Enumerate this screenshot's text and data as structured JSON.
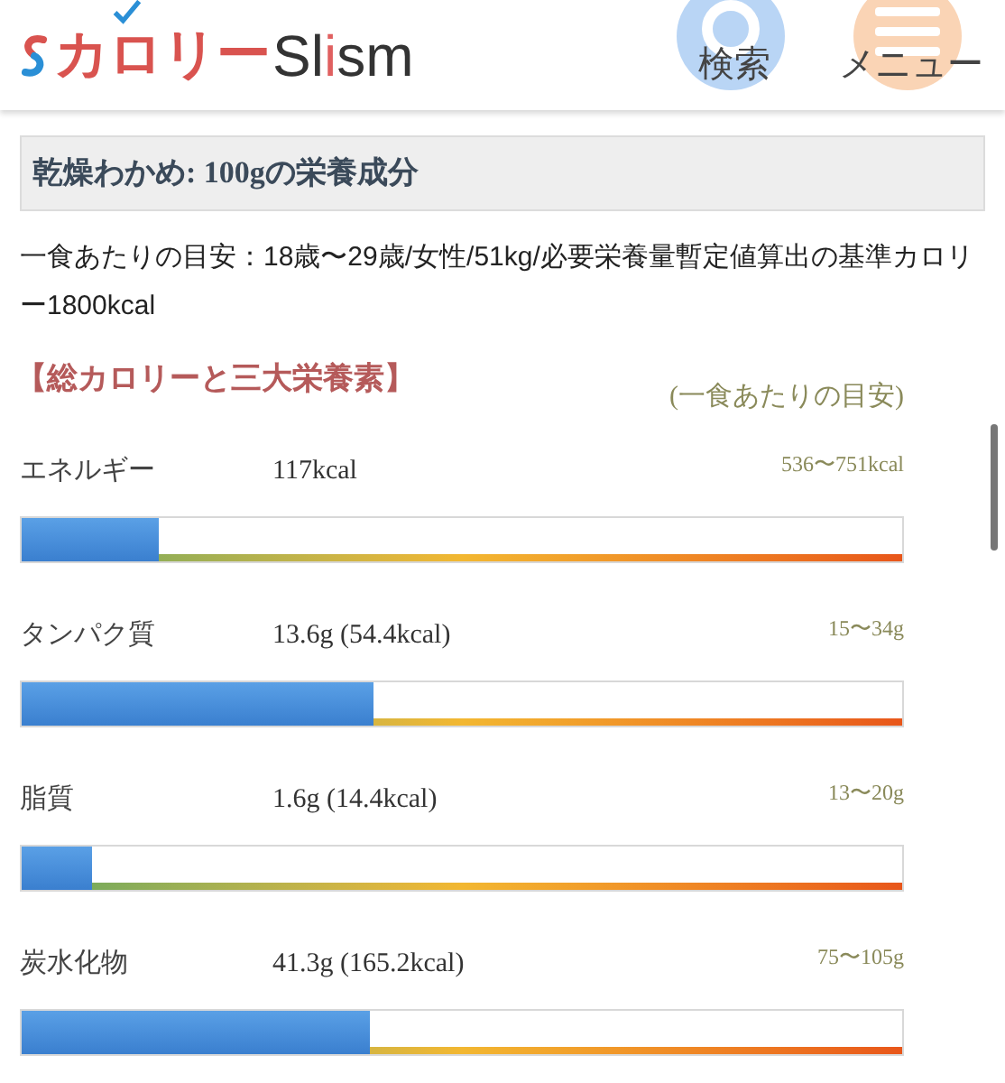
{
  "header": {
    "logo": {
      "kana": "カロリー",
      "word_parts": [
        {
          "text": "Sl",
          "color": "#333333"
        },
        {
          "text": "i",
          "color": "#e06060"
        },
        {
          "text": "sm",
          "color": "#333333"
        }
      ]
    },
    "buttons": [
      {
        "kind": "search",
        "label": "検索"
      },
      {
        "kind": "menu",
        "label": "メニュー"
      }
    ]
  },
  "title": "乾燥わかめ: 100gの栄養成分",
  "description": "一食あたりの目安：18歳〜29歳/女性/51kg/必要栄養量暫定値算出の基準カロリー1800kcal",
  "section": {
    "heading": "【総カロリーと三大栄養素】",
    "subheading": "(一食あたりの目安)"
  },
  "nutrients": [
    {
      "name": "エネルギー",
      "amount": "117kcal",
      "range": "536〜751kcal",
      "level": 0.155
    },
    {
      "name": "タンパク質",
      "amount": "13.6g (54.4kcal)",
      "range": "15〜34g",
      "level": 0.4
    },
    {
      "name": "脂質",
      "amount": "1.6g (14.4kcal)",
      "range": "13〜20g",
      "level": 0.08
    },
    {
      "name": "炭水化物",
      "amount": "41.3g (165.2kcal)",
      "range": "75〜105g",
      "level": 0.395
    }
  ]
}
